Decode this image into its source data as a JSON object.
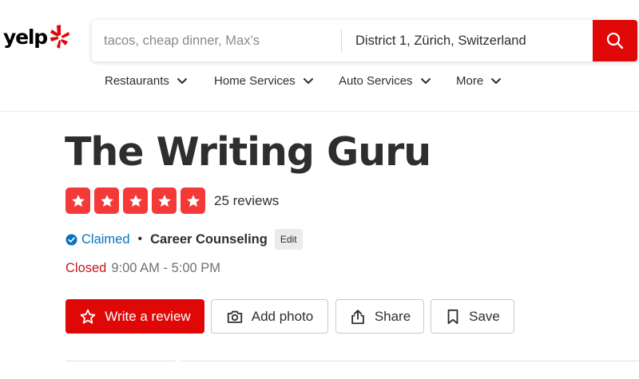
{
  "header": {
    "logo_text": "yelp",
    "search": {
      "what_placeholder": "tacos, cheap dinner, Max’s",
      "where_value": "District 1, Zürich, Switzerland"
    },
    "nav": [
      {
        "label": "Restaurants"
      },
      {
        "label": "Home Services"
      },
      {
        "label": "Auto Services"
      },
      {
        "label": "More"
      }
    ]
  },
  "business": {
    "name": "The Writing Guru",
    "rating": 5,
    "rating_max": 5,
    "review_count": "25 reviews",
    "claimed_label": "Claimed",
    "separator": "•",
    "category": "Career Counseling",
    "edit_label": "Edit",
    "status": "Closed",
    "hours": "9:00 AM - 5:00 PM"
  },
  "actions": {
    "write_review": "Write a review",
    "add_photo": "Add photo",
    "share": "Share",
    "save": "Save"
  },
  "colors": {
    "brand_red": "#e00707",
    "star_red": "#f43939",
    "claimed_blue": "#0a73bd",
    "closed_red": "#c4171c"
  }
}
